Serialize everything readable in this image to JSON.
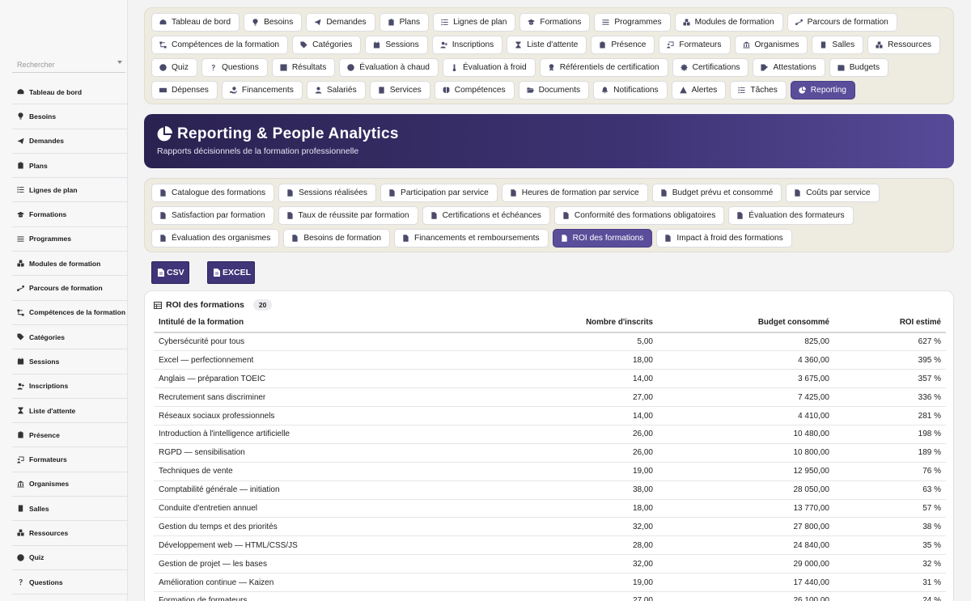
{
  "search": {
    "placeholder": "Rechercher"
  },
  "sidebar": {
    "items": [
      {
        "label": "Tableau de bord",
        "icon": "gauge-icon"
      },
      {
        "label": "Besoins",
        "icon": "lightbulb-icon"
      },
      {
        "label": "Demandes",
        "icon": "paper-plane-icon"
      },
      {
        "label": "Plans",
        "icon": "clipboard-icon"
      },
      {
        "label": "Lignes de plan",
        "icon": "list-icon"
      },
      {
        "label": "Formations",
        "icon": "graduation-cap-icon"
      },
      {
        "label": "Programmes",
        "icon": "bars-icon"
      },
      {
        "label": "Modules de formation",
        "icon": "cubes-icon"
      },
      {
        "label": "Parcours de formation",
        "icon": "route-icon"
      },
      {
        "label": "Compétences de la formation",
        "icon": "sitemap-icon"
      },
      {
        "label": "Catégories",
        "icon": "tags-icon"
      },
      {
        "label": "Sessions",
        "icon": "calendar-icon"
      },
      {
        "label": "Inscriptions",
        "icon": "user-plus-icon"
      },
      {
        "label": "Liste d'attente",
        "icon": "hourglass-icon"
      },
      {
        "label": "Présence",
        "icon": "clipboard-check-icon"
      },
      {
        "label": "Formateurs",
        "icon": "chalkboard-teacher-icon"
      },
      {
        "label": "Organismes",
        "icon": "building-columns-icon"
      },
      {
        "label": "Salles",
        "icon": "door-icon"
      },
      {
        "label": "Ressources",
        "icon": "boxes-icon"
      },
      {
        "label": "Quiz",
        "icon": "question-circle-icon"
      },
      {
        "label": "Questions",
        "icon": "question-icon"
      }
    ]
  },
  "nav": {
    "chips": [
      {
        "label": "Tableau de bord",
        "icon": "gauge-icon",
        "name": "tableau-de-bord"
      },
      {
        "label": "Besoins",
        "icon": "lightbulb-icon",
        "name": "besoins"
      },
      {
        "label": "Demandes",
        "icon": "paper-plane-icon",
        "name": "demandes"
      },
      {
        "label": "Plans",
        "icon": "clipboard-icon",
        "name": "plans"
      },
      {
        "label": "Lignes de plan",
        "icon": "list-icon",
        "name": "lignes-de-plan"
      },
      {
        "label": "Formations",
        "icon": "graduation-cap-icon",
        "name": "formations"
      },
      {
        "label": "Programmes",
        "icon": "bars-icon",
        "name": "programmes"
      },
      {
        "label": "Modules de formation",
        "icon": "cubes-icon",
        "name": "modules-de-formation"
      },
      {
        "label": "Parcours de formation",
        "icon": "route-icon",
        "name": "parcours-de-formation"
      },
      {
        "label": "Compétences de la formation",
        "icon": "sitemap-icon",
        "name": "competences-de-la-formation"
      },
      {
        "label": "Catégories",
        "icon": "tags-icon",
        "name": "categories"
      },
      {
        "label": "Sessions",
        "icon": "calendar-icon",
        "name": "sessions"
      },
      {
        "label": "Inscriptions",
        "icon": "user-plus-icon",
        "name": "inscriptions"
      },
      {
        "label": "Liste d'attente",
        "icon": "hourglass-icon",
        "name": "liste-d-attente"
      },
      {
        "label": "Présence",
        "icon": "clipboard-check-icon",
        "name": "presence"
      },
      {
        "label": "Formateurs",
        "icon": "chalkboard-teacher-icon",
        "name": "formateurs"
      },
      {
        "label": "Organismes",
        "icon": "building-columns-icon",
        "name": "organismes"
      },
      {
        "label": "Salles",
        "icon": "door-icon",
        "name": "salles"
      },
      {
        "label": "Ressources",
        "icon": "boxes-icon",
        "name": "ressources"
      },
      {
        "label": "Quiz",
        "icon": "question-circle-icon",
        "name": "quiz"
      },
      {
        "label": "Questions",
        "icon": "question-icon",
        "name": "questions"
      },
      {
        "label": "Résultats",
        "icon": "poll-icon",
        "name": "resultats"
      },
      {
        "label": "Évaluation à chaud",
        "icon": "smile-icon",
        "name": "evaluation-a-chaud"
      },
      {
        "label": "Évaluation à froid",
        "icon": "thermometer-icon",
        "name": "evaluation-a-froid"
      },
      {
        "label": "Référentiels de certification",
        "icon": "award-icon",
        "name": "referentiels-de-certification"
      },
      {
        "label": "Certifications",
        "icon": "certificate-icon",
        "name": "certifications"
      },
      {
        "label": "Attestations",
        "icon": "file-signature-icon",
        "name": "attestations"
      },
      {
        "label": "Budgets",
        "icon": "wallet-icon",
        "name": "budgets"
      },
      {
        "label": "Dépenses",
        "icon": "money-bill-icon",
        "name": "depenses"
      },
      {
        "label": "Financements",
        "icon": "hand-holding-usd-icon",
        "name": "financements"
      },
      {
        "label": "Salariés",
        "icon": "user-icon",
        "name": "salaries"
      },
      {
        "label": "Services",
        "icon": "building-icon",
        "name": "services"
      },
      {
        "label": "Compétences",
        "icon": "brain-icon",
        "name": "competences"
      },
      {
        "label": "Documents",
        "icon": "folder-open-icon",
        "name": "documents"
      },
      {
        "label": "Notifications",
        "icon": "bell-icon",
        "name": "notifications"
      },
      {
        "label": "Alertes",
        "icon": "warning-icon",
        "name": "alertes"
      },
      {
        "label": "Tâches",
        "icon": "tasks-icon",
        "name": "taches"
      },
      {
        "label": "Reporting",
        "icon": "pie-chart-icon",
        "name": "reporting",
        "active": true
      }
    ]
  },
  "hero": {
    "title": "Reporting & People Analytics",
    "subtitle": "Rapports décisionnels de la formation professionnelle"
  },
  "reports": {
    "chips": [
      {
        "label": "Catalogue des formations",
        "name": "catalogue-des-formations"
      },
      {
        "label": "Sessions réalisées",
        "name": "sessions-realisees"
      },
      {
        "label": "Participation par service",
        "name": "participation-par-service"
      },
      {
        "label": "Heures de formation par service",
        "name": "heures-de-formation-par-service"
      },
      {
        "label": "Budget prévu et consommé",
        "name": "budget-prevu-et-consomme"
      },
      {
        "label": "Coûts par service",
        "name": "couts-par-service"
      },
      {
        "label": "Satisfaction par formation",
        "name": "satisfaction-par-formation"
      },
      {
        "label": "Taux de réussite par formation",
        "name": "taux-de-reussite-par-formation"
      },
      {
        "label": "Certifications et échéances",
        "name": "certifications-et-echeances"
      },
      {
        "label": "Conformité des formations obligatoires",
        "name": "conformite-des-formations-obligatoires"
      },
      {
        "label": "Évaluation des formateurs",
        "name": "evaluation-des-formateurs"
      },
      {
        "label": "Évaluation des organismes",
        "name": "evaluation-des-organismes"
      },
      {
        "label": "Besoins de formation",
        "name": "besoins-de-formation"
      },
      {
        "label": "Financements et remboursements",
        "name": "financements-et-remboursements"
      },
      {
        "label": "ROI des formations",
        "name": "roi-des-formations",
        "active": true
      },
      {
        "label": "Impact à froid des formations",
        "name": "impact-a-froid-des-formations"
      }
    ]
  },
  "export": {
    "csv_label": "CSV",
    "excel_label": "EXCEL"
  },
  "table": {
    "title": "ROI des formations",
    "count": "20",
    "columns": [
      "Intitulé de la formation",
      "Nombre d'inscrits",
      "Budget consommé",
      "ROI estimé"
    ],
    "rows": [
      [
        "Cybersécurité pour tous",
        "5,00",
        "825,00",
        "627 %"
      ],
      [
        "Excel — perfectionnement",
        "18,00",
        "4 360,00",
        "395 %"
      ],
      [
        "Anglais — préparation TOEIC",
        "14,00",
        "3 675,00",
        "357 %"
      ],
      [
        "Recrutement sans discriminer",
        "27,00",
        "7 425,00",
        "336 %"
      ],
      [
        "Réseaux sociaux professionnels",
        "14,00",
        "4 410,00",
        "281 %"
      ],
      [
        "Introduction à l'intelligence artificielle",
        "26,00",
        "10 480,00",
        "198 %"
      ],
      [
        "RGPD — sensibilisation",
        "26,00",
        "10 800,00",
        "189 %"
      ],
      [
        "Techniques de vente",
        "19,00",
        "12 950,00",
        "76 %"
      ],
      [
        "Comptabilité générale — initiation",
        "38,00",
        "28 050,00",
        "63 %"
      ],
      [
        "Conduite d'entretien annuel",
        "18,00",
        "13 770,00",
        "57 %"
      ],
      [
        "Gestion du temps et des priorités",
        "32,00",
        "27 800,00",
        "38 %"
      ],
      [
        "Développement web — HTML/CSS/JS",
        "28,00",
        "24 840,00",
        "35 %"
      ],
      [
        "Gestion de projet — les bases",
        "32,00",
        "29 000,00",
        "32 %"
      ],
      [
        "Amélioration continue — Kaizen",
        "19,00",
        "17 440,00",
        "31 %"
      ],
      [
        "Formation de formateurs",
        "27,00",
        "26 100,00",
        "24 %"
      ]
    ]
  },
  "colors": {
    "accent": "#5a4d9a",
    "hero_dark": "#2a2250",
    "panel": "#eeebe0"
  }
}
